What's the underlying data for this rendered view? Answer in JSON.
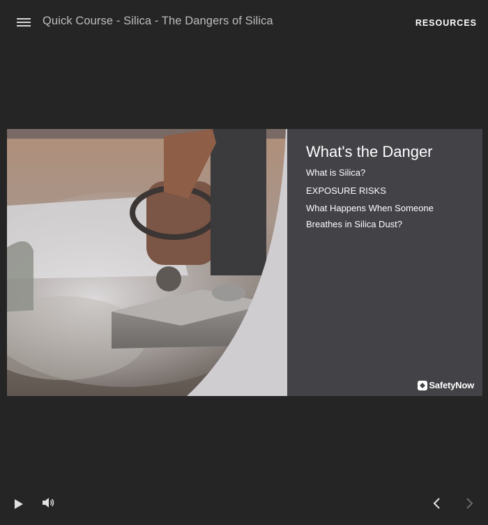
{
  "header": {
    "course_title": "Quick Course - Silica - The Dangers of Silica",
    "resources_label": "RESOURCES"
  },
  "slide": {
    "title": "What's the Danger",
    "links": [
      "What is Silica?",
      "EXPOSURE RISKS",
      "What Happens When Someone",
      "Breathes in Silica Dust?"
    ],
    "brand_name": "SafetyNow"
  },
  "footer": {
    "icons": [
      "play-icon",
      "volume-icon",
      "previous-icon",
      "next-icon"
    ]
  },
  "colors": {
    "background": "#252525",
    "panel": "#424247",
    "header_text": "#bdbdbd",
    "white": "#ffffff"
  }
}
